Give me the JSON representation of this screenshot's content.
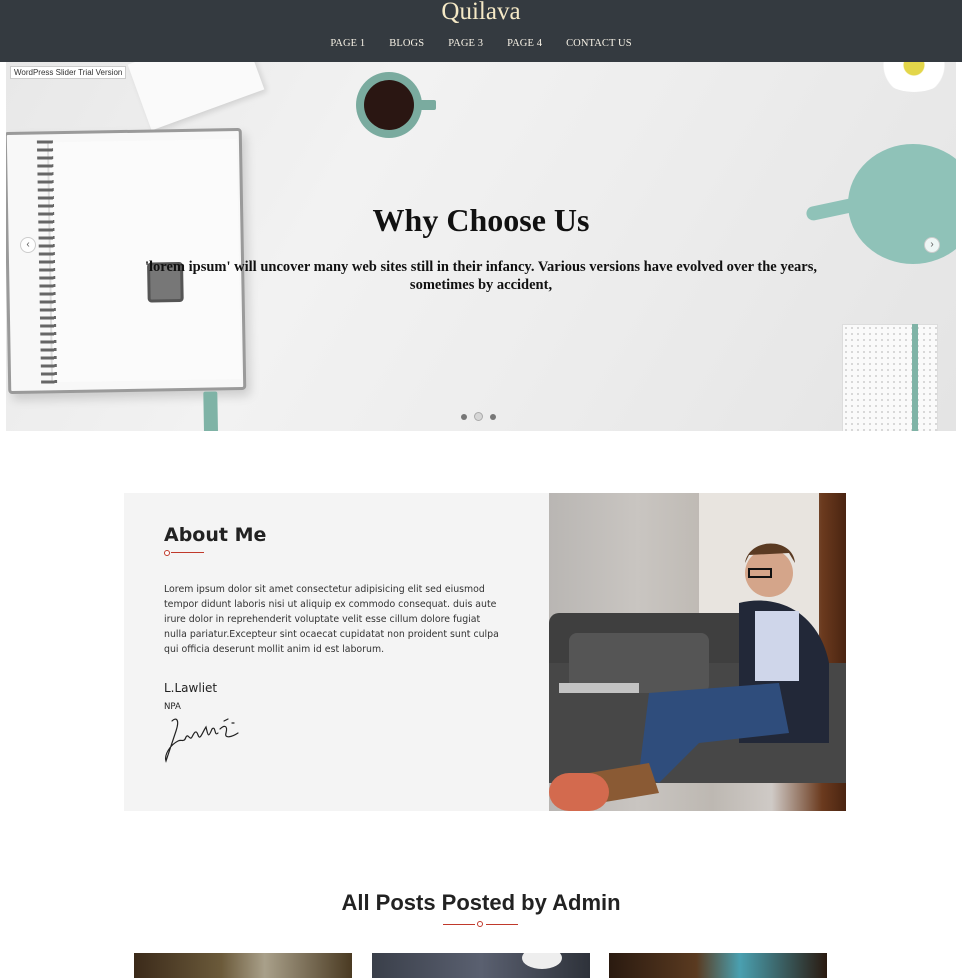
{
  "header": {
    "site_title": "Quilava",
    "nav": [
      "PAGE 1",
      "BLOGS",
      "PAGE 3",
      "PAGE 4",
      "CONTACT US"
    ]
  },
  "slider": {
    "trial_badge": "WordPress Slider Trial Version",
    "title": "Why Choose Us",
    "text": "'lorem ipsum' will uncover many web sites still in their infancy. Various versions have evolved over the years, sometimes by accident,",
    "prev_icon": "chevron-left-icon",
    "next_icon": "chevron-right-icon",
    "slide_count": 3,
    "active_slide": 2
  },
  "about": {
    "title": "About Me",
    "text": "Lorem ipsum dolor sit amet consectetur adipisicing elit sed eiusmod tempor didunt laboris nisi ut aliquip ex commodo consequat. duis aute irure dolor in reprehenderit voluptate velit esse cillum dolore fugiat nulla pariatur.Excepteur sint ocaecat cupidatat non proident sunt culpa qui officia deserunt mollit anim id est laborum.",
    "name": "L.Lawliet",
    "role": "NPA",
    "accent_color": "#c0392b"
  },
  "posts": {
    "title": "All Posts Posted by Admin"
  },
  "colors": {
    "header_bg": "#343a40",
    "title_color": "#f5e9c6",
    "about_bg": "#f4f4f4"
  }
}
